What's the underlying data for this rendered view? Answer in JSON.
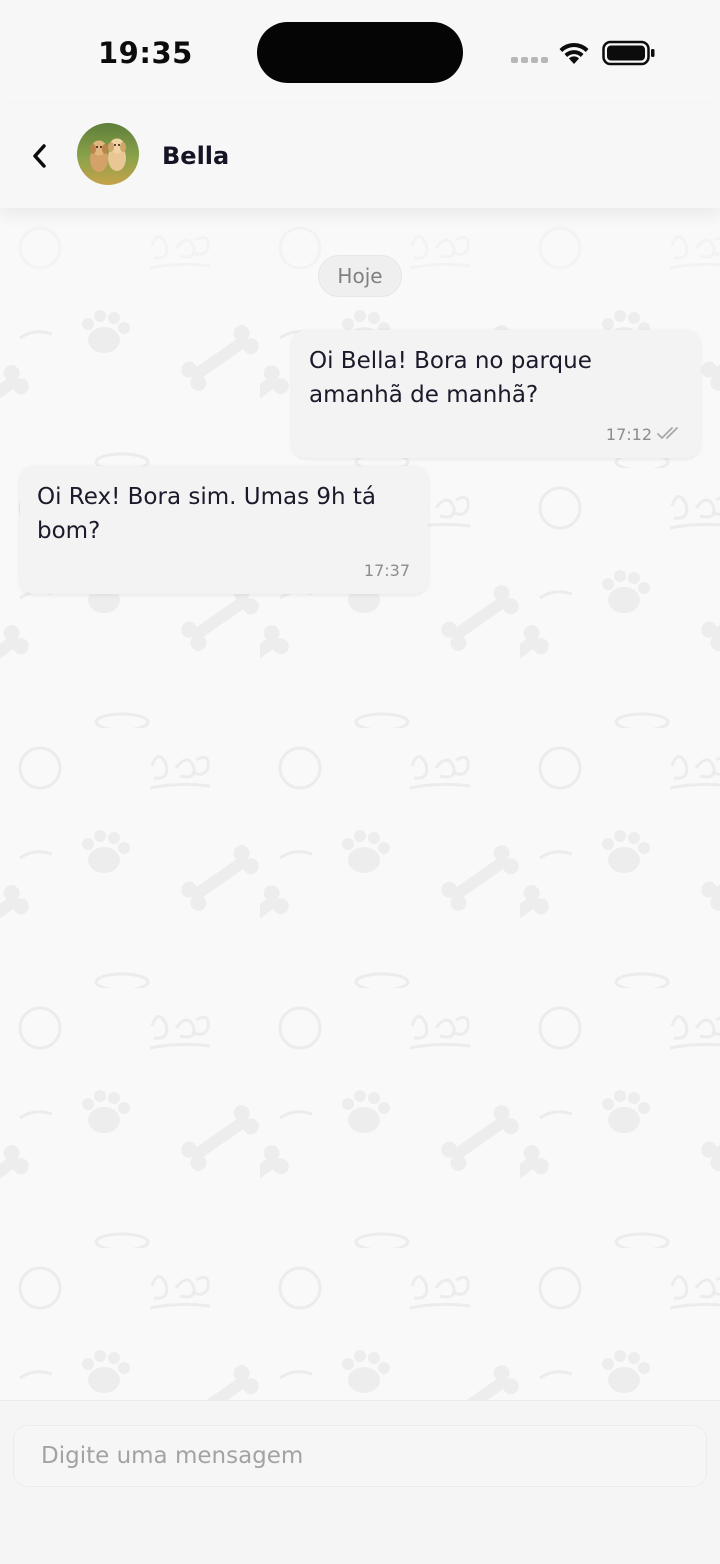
{
  "status_bar": {
    "time": "19:35"
  },
  "header": {
    "back_icon": "chevron-left-icon",
    "contact_name": "Bella"
  },
  "chat": {
    "day_label": "Hoje",
    "messages": [
      {
        "direction": "outgoing",
        "text": "Oi Bella! Bora no parque amanhã de manhã?",
        "time": "17:12",
        "status_icon": "double-check-icon"
      },
      {
        "direction": "incoming",
        "text": "Oi Rex! Bora sim. Umas 9h tá bom?",
        "time": "17:37"
      }
    ]
  },
  "composer": {
    "placeholder": "Digite uma mensagem"
  },
  "colors": {
    "background": "#f8f8f8",
    "bubble": "#f3f3f3",
    "text": "#1a1a2a",
    "muted": "#8c8c8c"
  }
}
